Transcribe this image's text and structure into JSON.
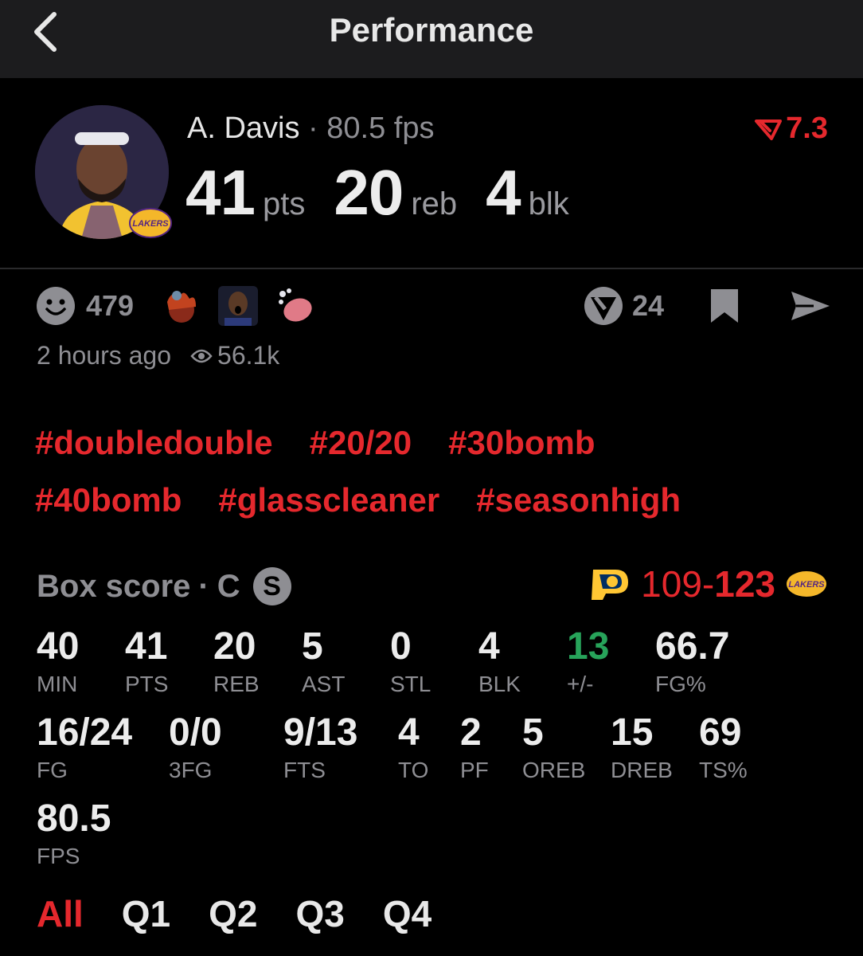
{
  "topbar": {
    "title": "Performance",
    "back_icon": "chevron-left-icon"
  },
  "player": {
    "name": "A. Davis",
    "separator": "·",
    "fps_label": "80.5 fps",
    "trend": {
      "icon": "trend-down-icon",
      "value": "7.3"
    },
    "team": "LAKERS"
  },
  "headline": [
    {
      "value": "41",
      "unit": "pts"
    },
    {
      "value": "20",
      "unit": "reb"
    },
    {
      "value": "4",
      "unit": "blk"
    }
  ],
  "reactions": {
    "icon": "smiley-icon",
    "count": "479"
  },
  "actions": {
    "votes": "24",
    "bookmark_icon": "bookmark-icon",
    "share_icon": "send-icon"
  },
  "meta": {
    "time": "2 hours ago",
    "views_icon": "eye-icon",
    "views": "56.1k"
  },
  "tags": [
    [
      "#doubledouble",
      "#20/20",
      "#30bomb"
    ],
    [
      "#40bomb",
      "#glasscleaner",
      "#seasonhigh"
    ]
  ],
  "box": {
    "title": "Box score",
    "separator": "·",
    "position": "C",
    "starter_badge": "S",
    "score_away": "109",
    "score_sep": "-",
    "score_home": "123"
  },
  "stats": {
    "row1": [
      {
        "value": "40",
        "label": "MIN"
      },
      {
        "value": "41",
        "label": "PTS"
      },
      {
        "value": "20",
        "label": "REB"
      },
      {
        "value": "5",
        "label": "AST"
      },
      {
        "value": "0",
        "label": "STL"
      },
      {
        "value": "4",
        "label": "BLK"
      },
      {
        "value": "13",
        "label": "+/-"
      },
      {
        "value": "66.7",
        "label": "FG%"
      }
    ],
    "row2": [
      {
        "value": "16/24",
        "label": "FG"
      },
      {
        "value": "0/0",
        "label": "3FG"
      },
      {
        "value": "9/13",
        "label": "FTS"
      },
      {
        "value": "4",
        "label": "TO"
      },
      {
        "value": "2",
        "label": "PF"
      },
      {
        "value": "5",
        "label": "OREB"
      },
      {
        "value": "15",
        "label": "DREB"
      },
      {
        "value": "69",
        "label": "TS%"
      }
    ],
    "row3": [
      {
        "value": "80.5",
        "label": "FPS"
      }
    ]
  },
  "periods": [
    "All",
    "Q1",
    "Q2",
    "Q3",
    "Q4"
  ],
  "colors": {
    "accent": "#e5282d",
    "positive": "#27a35a",
    "muted": "#8e8e93"
  }
}
